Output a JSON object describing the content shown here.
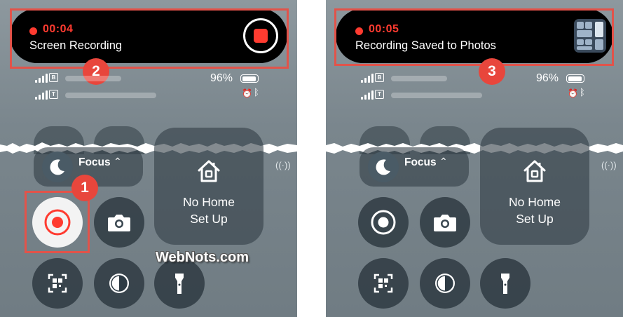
{
  "left": {
    "island": {
      "timer": "00:04",
      "title": "Screen Recording"
    },
    "status": {
      "battery": "96%",
      "sim1": "B",
      "sim2": "T"
    },
    "focus_label": "Focus",
    "home": {
      "line1": "No Home",
      "line2": "Set Up"
    },
    "badges": {
      "one": "1",
      "two": "2"
    }
  },
  "right": {
    "island": {
      "timer": "00:05",
      "title": "Recording Saved to Photos"
    },
    "status": {
      "battery": "96%",
      "sim1": "B",
      "sim2": "T"
    },
    "focus_label": "Focus",
    "home": {
      "line1": "No Home",
      "line2": "Set Up"
    },
    "badges": {
      "three": "3"
    }
  },
  "watermark": "WebNots.com",
  "colors": {
    "highlight": "#e2534a",
    "badge": "#e8463c",
    "record_red": "#ff3b30"
  }
}
